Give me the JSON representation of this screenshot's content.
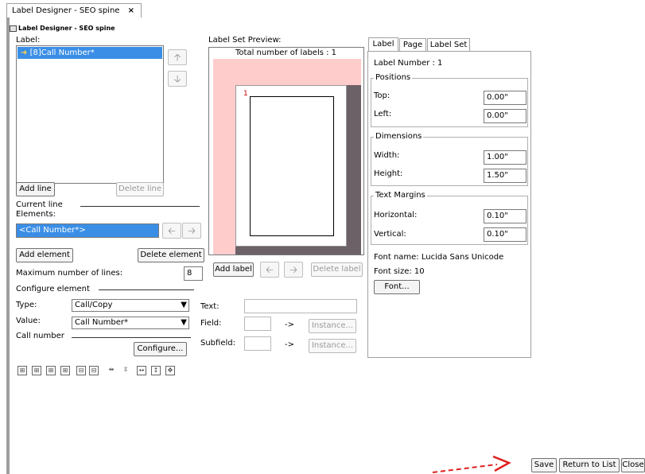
{
  "tab": {
    "title": "Label Designer - SEO spine",
    "close": "×"
  },
  "window": {
    "title": "Label Designer - SEO spine"
  },
  "left": {
    "label_heading": "Label:",
    "list_item": "[8]Call Number*",
    "add_line": "Add line",
    "delete_line": "Delete line",
    "current_line": "Current line",
    "elements": "Elements:",
    "element_value": "<Call Number*>",
    "add_element": "Add element",
    "delete_element": "Delete element",
    "max_lines_label": "Maximum number of lines:",
    "max_lines_value": "8",
    "configure_element": "Configure element",
    "type_label": "Type:",
    "type_value": "Call/Copy",
    "value_label": "Value:",
    "value_value": "Call Number*",
    "call_number": "Call number",
    "configure_button": "Configure..."
  },
  "middle": {
    "preview_heading": "Label Set Preview:",
    "total_labels": "Total number of labels : 1",
    "label_index": "1",
    "add_label": "Add label",
    "delete_label": "Delete label",
    "text_label": "Text:",
    "field_label": "Field:",
    "subfield_label": "Subfield:",
    "arrow": "->",
    "instance1": "Instance...",
    "instance2": "Instance..."
  },
  "right": {
    "tabs": [
      "Label",
      "Page",
      "Label Set"
    ],
    "label_number": "Label Number : 1",
    "positions": "Positions",
    "top_label": "Top:",
    "top_value": "0.00\"",
    "left_label": "Left:",
    "left_value": "0.00\"",
    "dimensions": "Dimensions",
    "width_label": "Width:",
    "width_value": "1.00\"",
    "height_label": "Height:",
    "height_value": "1.50\"",
    "text_margins": "Text Margins",
    "horizontal_label": "Horizontal:",
    "horizontal_value": "0.10\"",
    "vertical_label": "Vertical:",
    "vertical_value": "0.10\"",
    "font_name": "Font name: Lucida Sans Unicode",
    "font_size": "Font size: 10",
    "font_button": "Font..."
  },
  "bottom": {
    "save": "Save",
    "return": "Return to List",
    "close": "Close"
  },
  "colors": {
    "selection": "#3a8ee6",
    "preview_bg": "#ffcccc",
    "annotation": "#e02020"
  }
}
